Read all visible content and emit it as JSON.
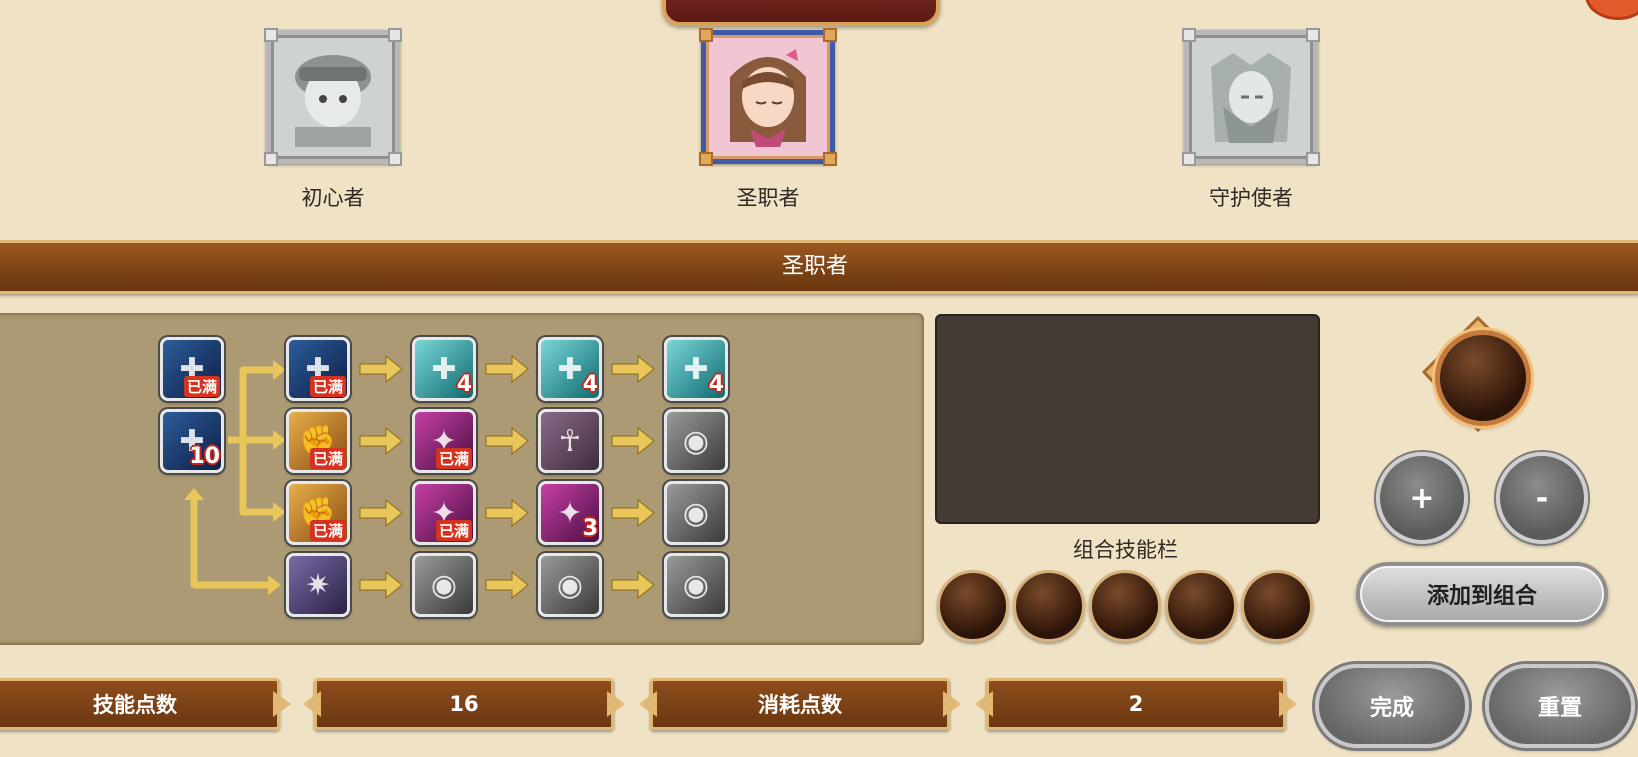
{
  "jobs": [
    {
      "name": "初心者",
      "active": false
    },
    {
      "name": "圣职者",
      "active": true
    },
    {
      "name": "守护使者",
      "active": false
    }
  ],
  "title_bar": {
    "label": "圣职者"
  },
  "skill_tree": {
    "badges": {
      "max": "已满"
    },
    "skills": [
      {
        "id": "base-1",
        "color": "c-blue",
        "badge": "已满",
        "badge_type": "max"
      },
      {
        "id": "base-2",
        "color": "c-blue",
        "badge": "10",
        "badge_type": "num"
      },
      {
        "id": "r1c1",
        "color": "c-blue",
        "badge": "已满",
        "badge_type": "max"
      },
      {
        "id": "r1c2",
        "color": "c-teal",
        "badge": "4",
        "badge_type": "num"
      },
      {
        "id": "r1c3",
        "color": "c-teal",
        "badge": "4",
        "badge_type": "num"
      },
      {
        "id": "r1c4",
        "color": "c-teal",
        "badge": "4",
        "badge_type": "num"
      },
      {
        "id": "r2c1",
        "color": "c-gold",
        "badge": "已满",
        "badge_type": "max"
      },
      {
        "id": "r2c2",
        "color": "c-mag",
        "badge": "已满",
        "badge_type": "max"
      },
      {
        "id": "r2c3",
        "color": "c-lock",
        "badge": "",
        "badge_type": "none"
      },
      {
        "id": "r2c4",
        "color": "c-gray",
        "badge": "",
        "badge_type": "none"
      },
      {
        "id": "r3c1",
        "color": "c-gold",
        "badge": "已满",
        "badge_type": "max"
      },
      {
        "id": "r3c2",
        "color": "c-mag",
        "badge": "已满",
        "badge_type": "max"
      },
      {
        "id": "r3c3",
        "color": "c-mag",
        "badge": "3",
        "badge_type": "num"
      },
      {
        "id": "r3c4",
        "color": "c-gray",
        "badge": "",
        "badge_type": "none"
      },
      {
        "id": "r4c1",
        "color": "c-purp",
        "badge": "",
        "badge_type": "none"
      },
      {
        "id": "r4c2",
        "color": "c-gray",
        "badge": "",
        "badge_type": "none"
      },
      {
        "id": "r4c3",
        "color": "c-gray",
        "badge": "",
        "badge_type": "none"
      },
      {
        "id": "r4c4",
        "color": "c-gray",
        "badge": "",
        "badge_type": "none"
      }
    ]
  },
  "combo": {
    "title": "组合技能栏",
    "slot_count": 5,
    "plus_label": "+",
    "minus_label": "-",
    "add_label": "添加到组合"
  },
  "stats": {
    "skill_points_label": "技能点数",
    "skill_points_value": "16",
    "cost_label": "消耗点数",
    "cost_value": "2"
  },
  "actions": {
    "done_label": "完成",
    "reset_label": "重置"
  },
  "colors": {
    "background": "#f0e2c4",
    "bar_brown": "#7a4114",
    "bar_trim": "#e1b873",
    "badge_red": "#d5331f",
    "arrow_yellow": "#e8c65a"
  }
}
